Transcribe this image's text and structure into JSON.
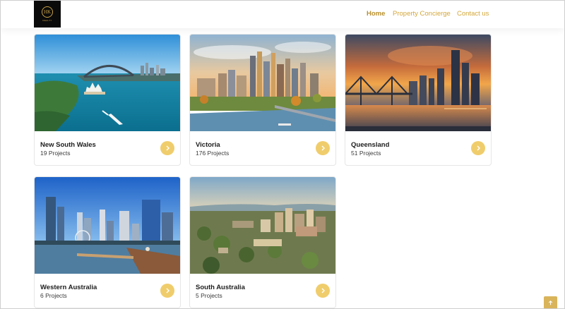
{
  "brand": {
    "logo_text": "HK",
    "logo_sub": "REALTY"
  },
  "nav": {
    "items": [
      {
        "label": "Home"
      },
      {
        "label": "Property Concierge"
      },
      {
        "label": "Contact us"
      }
    ]
  },
  "cards": [
    {
      "title": "New South Wales",
      "count": "19 Projects",
      "image": "sydney-harbour-opera-house"
    },
    {
      "title": "Victoria",
      "count": "176 Projects",
      "image": "melbourne-skyline-river"
    },
    {
      "title": "Queensland",
      "count": "51 Projects",
      "image": "brisbane-story-bridge-sunset"
    },
    {
      "title": "Western Australia",
      "count": "6 Projects",
      "image": "perth-skyline-jetty"
    },
    {
      "title": "South Australia",
      "count": "5 Projects",
      "image": "adelaide-aerial-city"
    }
  ],
  "colors": {
    "accent": "#f0cd6c",
    "nav": "#d4a73a",
    "scroll_top": "#d9b45a"
  },
  "icons": {
    "card_arrow": "chevron-right-icon",
    "scroll_top": "arrow-up-icon"
  }
}
